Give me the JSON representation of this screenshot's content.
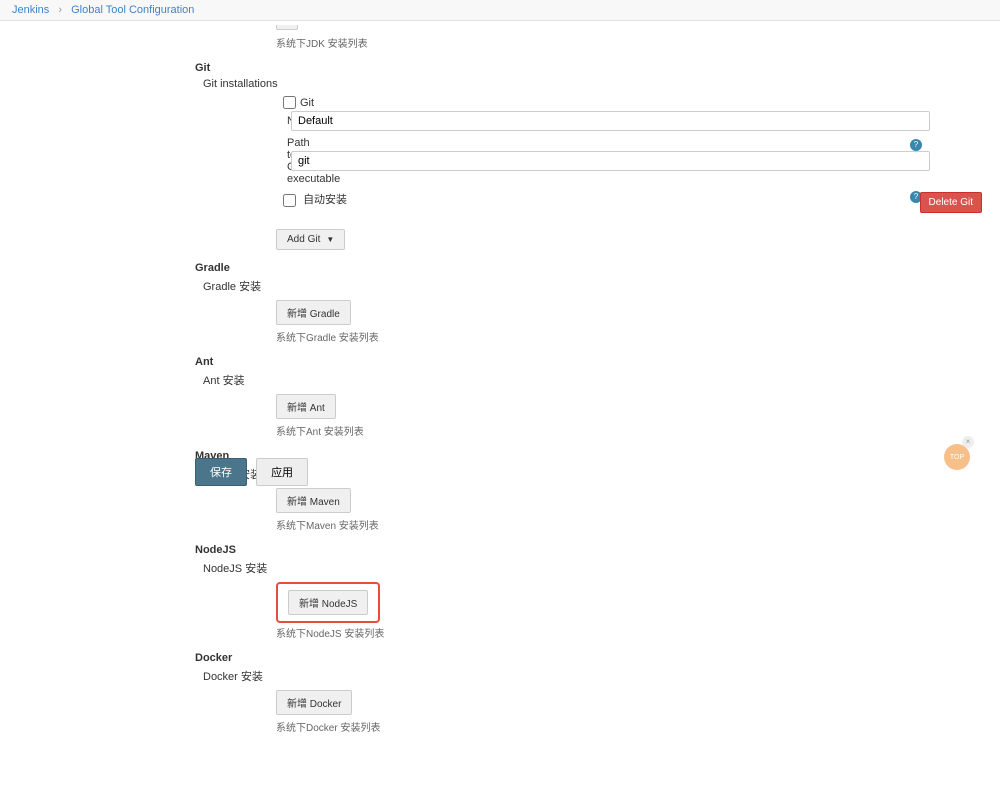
{
  "breadcrumb": {
    "root": "Jenkins",
    "page": "Global Tool Configuration"
  },
  "top_partial": {
    "btn_label": "",
    "hint": "系统下JDK 安装列表"
  },
  "git": {
    "title": "Git",
    "installations_label": "Git installations",
    "git_sub": "Git",
    "name_label": "Name",
    "name_value": "Default",
    "path_label": "Path to Git executable",
    "path_value": "git",
    "auto_install_label": "自动安装",
    "auto_install_checked": false,
    "delete_label": "Delete Git",
    "add_label": "Add Git"
  },
  "gradle": {
    "title": "Gradle",
    "install_label": "Gradle 安装",
    "add_btn": "新增 Gradle",
    "hint": "系统下Gradle 安装列表"
  },
  "ant": {
    "title": "Ant",
    "install_label": "Ant 安装",
    "add_btn": "新增 Ant",
    "hint": "系统下Ant 安装列表"
  },
  "maven": {
    "title": "Maven",
    "install_label": "Maven 安装",
    "add_btn": "新增 Maven",
    "hint": "系统下Maven 安装列表"
  },
  "nodejs": {
    "title": "NodeJS",
    "install_label": "NodeJS 安装",
    "add_btn": "新增 NodeJS",
    "hint": "系统下NodeJS 安装列表"
  },
  "docker": {
    "title": "Docker",
    "install_label": "Docker 安装",
    "add_btn": "新增 Docker",
    "hint": "系统下Docker 安装列表"
  },
  "footer": {
    "save": "保存",
    "apply": "应用",
    "top": "TOP"
  }
}
